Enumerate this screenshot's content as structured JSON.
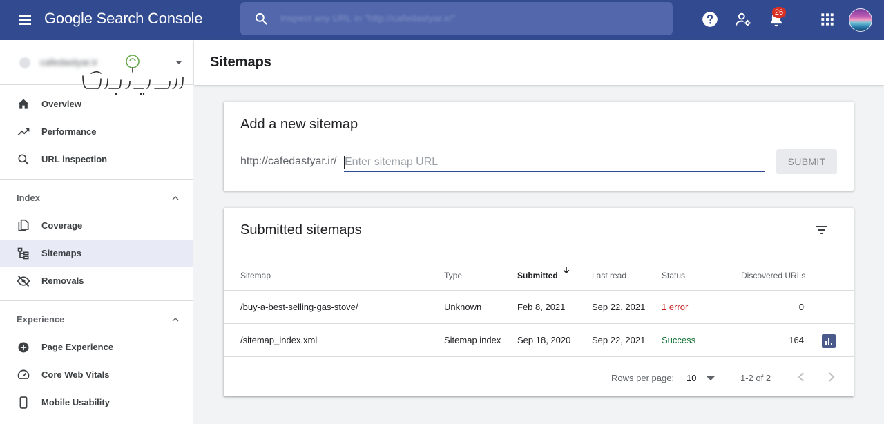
{
  "header": {
    "app_title": "Google Search Console",
    "search_placeholder": "Inspect any URL in \"http://cafedastyar.ir/\"",
    "notifications_count": "26"
  },
  "sidebar": {
    "property_name": "cafedastyar.ir",
    "nav_top": [
      {
        "label": "Overview",
        "icon": "home-icon"
      },
      {
        "label": "Performance",
        "icon": "trending-up-icon"
      },
      {
        "label": "URL inspection",
        "icon": "search-icon"
      }
    ],
    "sections": [
      {
        "title": "Index",
        "items": [
          {
            "label": "Coverage",
            "icon": "file-copy-icon"
          },
          {
            "label": "Sitemaps",
            "icon": "sitemap-icon",
            "active": true
          },
          {
            "label": "Removals",
            "icon": "visibility-off-icon"
          }
        ]
      },
      {
        "title": "Experience",
        "items": [
          {
            "label": "Page Experience",
            "icon": "add-circle-icon"
          },
          {
            "label": "Core Web Vitals",
            "icon": "speed-icon"
          },
          {
            "label": "Mobile Usability",
            "icon": "smartphone-icon"
          }
        ]
      }
    ]
  },
  "page": {
    "title": "Sitemaps"
  },
  "add_sitemap": {
    "title": "Add a new sitemap",
    "url_prefix": "http://cafedastyar.ir/",
    "input_placeholder": "Enter sitemap URL",
    "input_value": "",
    "submit_label": "SUBMIT"
  },
  "submitted": {
    "title": "Submitted sitemaps",
    "columns": [
      "Sitemap",
      "Type",
      "Submitted",
      "Last read",
      "Status",
      "Discovered URLs"
    ],
    "sorted_column": "Submitted",
    "rows": [
      {
        "sitemap": "/buy-a-best-selling-gas-stove/",
        "type": "Unknown",
        "submitted": "Feb 8, 2021",
        "last_read": "Sep 22, 2021",
        "status": "1 error",
        "discovered": "0"
      },
      {
        "sitemap": "/sitemap_index.xml",
        "type": "Sitemap index",
        "submitted": "Sep 18, 2020",
        "last_read": "Sep 22, 2021",
        "status": "Success",
        "discovered": "164"
      }
    ],
    "rows_per_page_label": "Rows per page:",
    "rows_per_page": "10",
    "range": "1-2 of 2"
  },
  "colors": {
    "topbar": "#324a8f",
    "error": "#c5221f",
    "success": "#137333",
    "active_nav": "#e8eaf6"
  }
}
